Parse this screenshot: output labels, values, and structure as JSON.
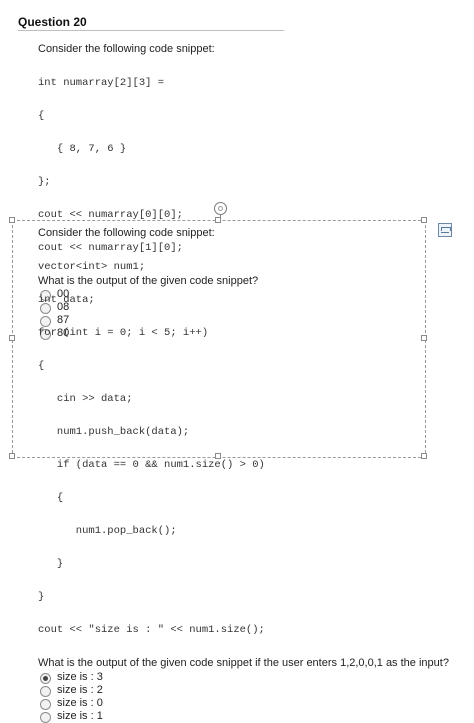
{
  "question": {
    "title": "Question 20"
  },
  "part1": {
    "prompt": "Consider the following code snippet:",
    "code": [
      "int numarray[2][3] =",
      "{",
      "   { 8, 7, 6 }",
      "};",
      "cout << numarray[0][0];",
      "cout << numarray[1][0];"
    ],
    "question_text": "What is the output of the given code snippet?",
    "options": [
      {
        "label": "00",
        "selected": false
      },
      {
        "label": "08",
        "selected": false
      },
      {
        "label": "87",
        "selected": false
      },
      {
        "label": "80",
        "selected": false
      }
    ]
  },
  "part2": {
    "prompt": "Consider the following code snippet:",
    "code": [
      "vector<int> num1;",
      "int data;",
      "for (int i = 0; i < 5; i++)",
      "{",
      "   cin >> data;",
      "   num1.push_back(data);",
      "   if (data == 0 && num1.size() > 0)",
      "   {",
      "      num1.pop_back();",
      "   }",
      "}",
      "cout << \"size is : \" << num1.size();"
    ],
    "question_text": "What is the output of the given code snippet if the user enters 1,2,0,0,1 as the input?",
    "options": [
      {
        "label": "size is : 3",
        "selected": true
      },
      {
        "label": "size is : 2",
        "selected": false
      },
      {
        "label": "size is : 0",
        "selected": false
      },
      {
        "label": "size is : 1",
        "selected": false
      }
    ]
  },
  "icons": {
    "rotate_handle": "rotate-handle-icon",
    "layout_options": "layout-options-icon",
    "radio": "radio-button-icon"
  },
  "colors": {
    "selection_border": "#9a9a9a",
    "radio_fill": "#f2f2f2",
    "layout_button_border": "#6d87a6"
  }
}
